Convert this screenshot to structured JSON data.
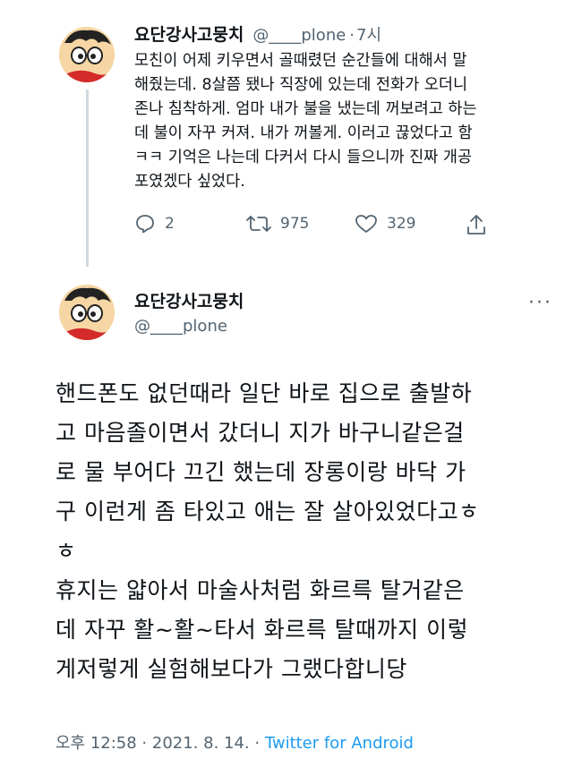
{
  "tweet1": {
    "name": "요단강사고뭉치",
    "handle": "@____plone",
    "dot": "·",
    "time": "7시",
    "text": "모친이 어제 키우면서 골때렸던 순간들에 대해서 말\n해줬는데. 8살쯤 됐나 직장에 있는데 전화가 오더니\n존나 침착하게. 엄마 내가 불을 냈는데 꺼보려고 하는\n데 불이 자꾸 커져. 내가 꺼볼게. 이러고 끊었다고 함\nㅋㅋ 기억은 나는데 다커서 다시 들으니까 진짜 개공\n포였겠다 싶었다.",
    "replies": "2",
    "retweets": "975",
    "likes": "329"
  },
  "tweet2": {
    "name": "요단강사고뭉치",
    "handle": "@____plone",
    "more": "···",
    "text": "핸드폰도 없던때라 일단 바로 집으로 출발하\n고 마음졸이면서 갔더니 지가 바구니같은걸\n로 물 부어다 끄긴 했는데 장롱이랑 바닥 가\n구 이런게 좀 타있고 애는 잘 살아있었다고ㅎ\nㅎ\n휴지는 얇아서 마술사처럼 화르륵 탈거같은\n데 자꾸 활~활~타서 화르륵 탈때까지 이렇\n게저렇게 실험해보다가 그랬다합니당",
    "timestamp": "오후 12:58 · 2021. 8. 14. · ",
    "source": "Twitter for Android"
  },
  "colors": {
    "text": "#0f1419",
    "secondary": "#536471",
    "link": "#1d9bf0"
  }
}
